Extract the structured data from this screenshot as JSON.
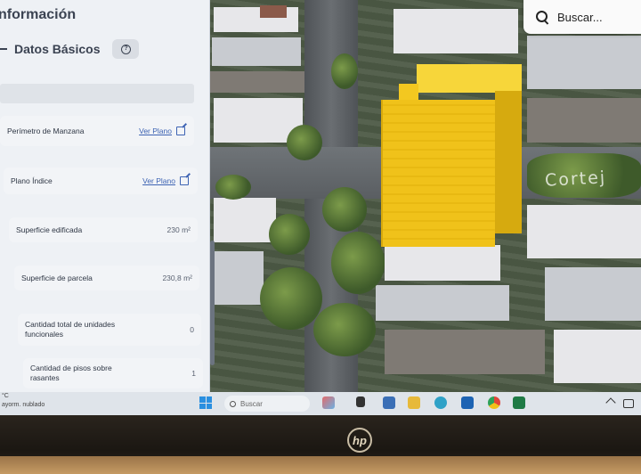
{
  "panel": {
    "title": "nformación",
    "section_label": "Datos Básicos",
    "help_icon": "question-circle-icon",
    "rows": [
      {
        "label": "Perímetro de Manzana",
        "link_text": "Ver Plano",
        "icon": "external-link-icon"
      },
      {
        "label": "Plano Índice",
        "link_text": "Ver Plano",
        "icon": "external-link-icon"
      },
      {
        "label": "Superficie edificada",
        "value": "230 m²"
      },
      {
        "label": "Superficie de parcela",
        "value": "230,8 m²"
      },
      {
        "label": "Cantidad total de unidades funcionales",
        "value": "0"
      },
      {
        "label": "Cantidad de pisos sobre rasantes",
        "value": "1"
      }
    ]
  },
  "search": {
    "placeholder": "Buscar...",
    "icon": "search-icon"
  },
  "map": {
    "street_label": "Cortej"
  },
  "taskbar": {
    "weather_temp": "°C",
    "weather_desc": "ayorm. nublado",
    "search_text": "Buscar"
  },
  "laptop": {
    "brand": "hp"
  },
  "colors": {
    "highlight_building": "#f0c21a",
    "link": "#3d63b3",
    "panel_bg": "#eef1f5"
  }
}
